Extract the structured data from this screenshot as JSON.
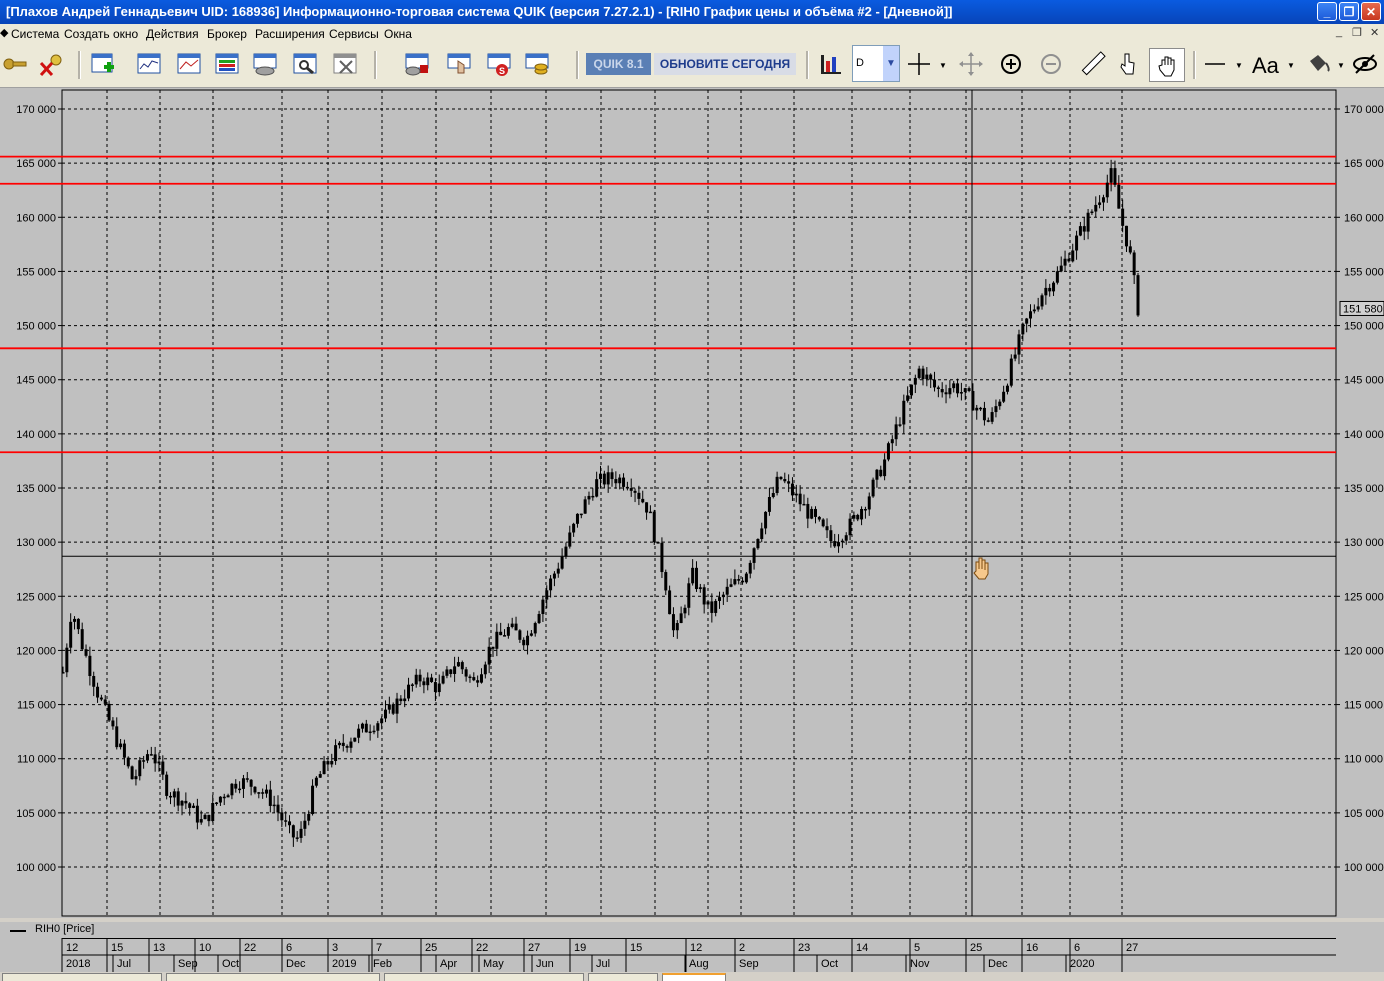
{
  "window": {
    "title": "[Плахов Андрей Геннадьевич UID: 168936] Информационно-торговая система QUIK (версия 7.27.2.1) - [RIH0 График цены и объёма #2 - [Дневной]]"
  },
  "menu": {
    "items": [
      "Система",
      "Создать окно",
      "Действия",
      "Брокер",
      "Расширения",
      "Сервисы",
      "Окна"
    ]
  },
  "toolbar": {
    "promo_badge": "QUIK 8.1",
    "promo_text": "ОБНОВИТЕ СЕГОДНЯ",
    "interval_value": "D",
    "font_button": "Aa"
  },
  "chart": {
    "current_price_label": "151 580",
    "legend_label": "RIH0 [Price]",
    "y_ticks": [
      "170 000",
      "165 000",
      "160 000",
      "155 000",
      "150 000",
      "145 000",
      "140 000",
      "135 000",
      "130 000",
      "125 000",
      "120 000",
      "115 000",
      "110 000",
      "105 000",
      "100 000"
    ],
    "x_days": [
      "12",
      "15",
      "13",
      "10",
      "22",
      "6",
      "3",
      "7",
      "25",
      "22",
      "27",
      "19",
      "15",
      "12",
      "2",
      "23",
      "14",
      "5",
      "25",
      "16",
      "6",
      "27"
    ],
    "x_months": [
      "2018",
      "Jul",
      "Sep",
      "Oct",
      "Dec",
      "2019",
      "Feb",
      "Apr",
      "May",
      "Jun",
      "Jul",
      "Aug",
      "Sep",
      "Oct",
      "Nov",
      "Dec",
      "2020"
    ],
    "colors": {
      "background": "#c0c0c0",
      "horizontal_lines": "#ff0000",
      "candles": "#000000",
      "grid": "#000000"
    }
  },
  "chart_data": {
    "type": "candlestick",
    "ylim": [
      96000,
      172000
    ],
    "y_ticks": [
      100000,
      105000,
      110000,
      115000,
      120000,
      125000,
      130000,
      135000,
      140000,
      145000,
      150000,
      155000,
      160000,
      165000,
      170000
    ],
    "horizontal_levels": [
      165600,
      163100,
      147900,
      138300
    ],
    "crosshair": {
      "price": 128700
    },
    "last_price": 151580,
    "series": [
      {
        "name": "RIH0 [Price]",
        "close_path": [
          [
            0,
            118000
          ],
          [
            1,
            124000
          ],
          [
            2,
            121000
          ],
          [
            4,
            116000
          ],
          [
            6,
            112000
          ],
          [
            8,
            108000
          ],
          [
            10,
            111000
          ],
          [
            12,
            107000
          ],
          [
            14,
            106000
          ],
          [
            16,
            104000
          ],
          [
            18,
            106500
          ],
          [
            20,
            108000
          ],
          [
            22,
            107500
          ],
          [
            24,
            106000
          ],
          [
            26,
            103000
          ],
          [
            27,
            102500
          ],
          [
            29,
            108000
          ],
          [
            31,
            110500
          ],
          [
            33,
            112000
          ],
          [
            35,
            113000
          ],
          [
            37,
            114000
          ],
          [
            39,
            116000
          ],
          [
            41,
            117500
          ],
          [
            43,
            116500
          ],
          [
            45,
            119000
          ],
          [
            47,
            117000
          ],
          [
            49,
            120500
          ],
          [
            51,
            122000
          ],
          [
            53,
            121000
          ],
          [
            55,
            125000
          ],
          [
            57,
            128500
          ],
          [
            59,
            132500
          ],
          [
            61,
            135500
          ],
          [
            63,
            136000
          ],
          [
            65,
            135500
          ],
          [
            67,
            133000
          ],
          [
            69,
            126000
          ],
          [
            70,
            121000
          ],
          [
            72,
            127000
          ],
          [
            74,
            123500
          ],
          [
            76,
            125500
          ],
          [
            78,
            127000
          ],
          [
            80,
            132000
          ],
          [
            82,
            136000
          ],
          [
            84,
            134000
          ],
          [
            86,
            132000
          ],
          [
            88,
            130000
          ],
          [
            90,
            131500
          ],
          [
            92,
            134000
          ],
          [
            94,
            137500
          ],
          [
            96,
            142000
          ],
          [
            98,
            146000
          ],
          [
            100,
            144000
          ],
          [
            102,
            144500
          ],
          [
            104,
            143000
          ],
          [
            106,
            141000
          ],
          [
            108,
            145000
          ],
          [
            110,
            150000
          ],
          [
            112,
            153000
          ],
          [
            114,
            155000
          ],
          [
            116,
            158000
          ],
          [
            118,
            161000
          ],
          [
            119,
            162500
          ],
          [
            120,
            164000
          ],
          [
            121,
            160000
          ],
          [
            122,
            157000
          ],
          [
            123,
            151580
          ]
        ]
      }
    ]
  }
}
